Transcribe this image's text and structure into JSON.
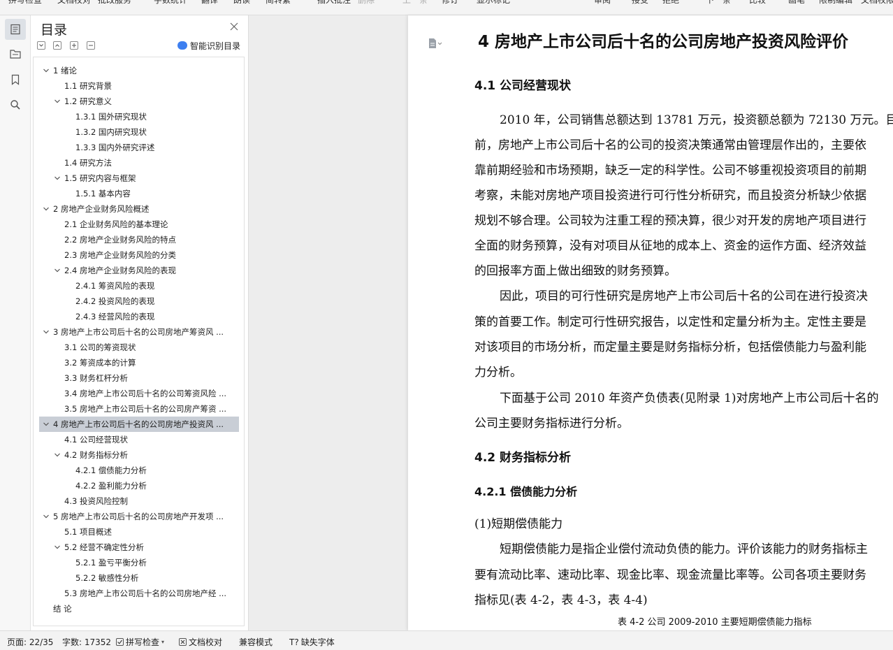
{
  "toolbar": {
    "items": [
      "拼写检查",
      "文档校对",
      "批改服务",
      "字数统计",
      "翻译",
      "朗读",
      "简转繁",
      "插入批注",
      "删除",
      "上一条",
      "下一条",
      "修订",
      "显示标记",
      "审阅",
      "接受",
      "拒绝",
      "下一条",
      "比较",
      "画笔",
      "限制编辑",
      "文档权限"
    ]
  },
  "rail": {
    "icons": [
      "toc-icon",
      "navigation-icon",
      "bookmark-icon",
      "search-icon"
    ]
  },
  "toc": {
    "title": "目录",
    "smart_label": "智能识别目录",
    "items": [
      {
        "level": 1,
        "text": "1  绪论",
        "expandable": true
      },
      {
        "level": 2,
        "text": "1.1 研究背景",
        "expandable": false
      },
      {
        "level": 2,
        "text": "1.2 研究意义",
        "expandable": true
      },
      {
        "level": 3,
        "text": "1.3.1 国外研究现状",
        "expandable": false
      },
      {
        "level": 3,
        "text": "1.3.2 国内研究现状",
        "expandable": false
      },
      {
        "level": 3,
        "text": "1.3.3 国内外研究评述",
        "expandable": false
      },
      {
        "level": 2,
        "text": "1.4 研究方法",
        "expandable": false
      },
      {
        "level": 2,
        "text": "1.5 研究内容与框架",
        "expandable": true
      },
      {
        "level": 3,
        "text": "1.5.1 基本内容",
        "expandable": false
      },
      {
        "level": 1,
        "text": "2 房地产企业财务风险概述",
        "expandable": true
      },
      {
        "level": 2,
        "text": "2.1  企业财务风险的基本理论",
        "expandable": false
      },
      {
        "level": 2,
        "text": "2.2 房地产企业财务风险的特点",
        "expandable": false
      },
      {
        "level": 2,
        "text": "2.3 房地产企业财务风险的分类",
        "expandable": false
      },
      {
        "level": 2,
        "text": "2.4 房地产企业财务风险的表现",
        "expandable": true
      },
      {
        "level": 3,
        "text": "2.4.1 筹资风险的表现",
        "expandable": false
      },
      {
        "level": 3,
        "text": "2.4.2 投资风险的表现",
        "expandable": false
      },
      {
        "level": 3,
        "text": "2.4.3 经营风险的表现",
        "expandable": false
      },
      {
        "level": 1,
        "text": "3 房地产上市公司后十名的公司房地产筹资风 ...",
        "expandable": true
      },
      {
        "level": 2,
        "text": "3.1 公司的筹资现状",
        "expandable": false
      },
      {
        "level": 2,
        "text": "3.2 筹资成本的计算",
        "expandable": false
      },
      {
        "level": 2,
        "text": "3.3 财务杠杆分析",
        "expandable": false
      },
      {
        "level": 2,
        "text": "3.4 房地产上市公司后十名的公司筹资风险 ...",
        "expandable": false
      },
      {
        "level": 2,
        "text": "3.5 房地产上市公司后十名的公司房产筹资 ...",
        "expandable": false
      },
      {
        "level": 1,
        "text": "4  房地产上市公司后十名的公司房地产投资风 ...",
        "expandable": true,
        "selected": true
      },
      {
        "level": 2,
        "text": "4.1 公司经营现状",
        "expandable": false
      },
      {
        "level": 2,
        "text": "4.2 财务指标分析",
        "expandable": true
      },
      {
        "level": 3,
        "text": "4.2.1 偿债能力分析",
        "expandable": false
      },
      {
        "level": 3,
        "text": "4.2.2 盈利能力分析",
        "expandable": false
      },
      {
        "level": 2,
        "text": "4.3 投资风险控制",
        "expandable": false
      },
      {
        "level": 1,
        "text": "5 房地产上市公司后十名的公司房地产开发项 ...",
        "expandable": true
      },
      {
        "level": 2,
        "text": "5.1 项目概述",
        "expandable": false
      },
      {
        "level": 2,
        "text": "5.2 经营不确定性分析",
        "expandable": true
      },
      {
        "level": 3,
        "text": "5.2.1 盈亏平衡分析",
        "expandable": false
      },
      {
        "level": 3,
        "text": "5.2.2 敏感性分析",
        "expandable": false
      },
      {
        "level": 2,
        "text": "5.3 房地产上市公司后十名的公司房地产经 ...",
        "expandable": false
      },
      {
        "level": 1,
        "text": "结    论",
        "expandable": false
      }
    ]
  },
  "document": {
    "heading1": "4  房地产上市公司后十名的公司房地产投资风险评价",
    "section_41": "4.1 公司经营现状",
    "para1": [
      "2010 年，公司销售总额达到 13781 万元，投资额总额为 72130 万元。目",
      "前，房地产上市公司后十名的公司的投资决策通常由管理层作出的，主要依",
      "靠前期经验和市场预期，缺乏一定的科学性。公司不够重视投资项目的前期",
      "考察，未能对房地产项目投资进行可行性分析研究，而且投资分析缺少依据",
      "规划不够合理。公司较为注重工程的预决算，很少对开发的房地产项目进行",
      "全面的财务预算，没有对项目从征地的成本上、资金的运作方面、经济效益",
      "的回报率方面上做出细致的财务预算。"
    ],
    "para2": [
      "因此，项目的可行性研究是房地产上市公司后十名的公司在进行投资决",
      "策的首要工作。制定可行性研究报告，以定性和定量分析为主。定性主要是",
      "对该项目的市场分析，而定量主要是财务指标分析，包括偿债能力与盈利能",
      "力分析。"
    ],
    "para3": [
      "下面基于公司 2010 年资产负债表(见附录 1)对房地产上市公司后十名的",
      "公司主要财务指标进行分析。"
    ],
    "section_42": "4.2 财务指标分析",
    "section_421": "4.2.1 偿债能力分析",
    "sub1": "(1)短期偿债能力",
    "para4": [
      "短期偿债能力是指企业偿付流动负债的能力。评价该能力的财务指标主",
      "要有流动比率、速动比率、现金比率、现金流量比率等。公司各项主要财务",
      "指标见(表 4-2，表 4-3，表 4-4)"
    ],
    "caption": "表 4-2 公司 2009-2010 主要短期偿债能力指标"
  },
  "status": {
    "page": "页面: 22/35",
    "words": "字数: 17352",
    "spell": "拼写检查",
    "proof": "文档校对",
    "compat": "兼容模式",
    "missing_font": "缺失字体"
  }
}
